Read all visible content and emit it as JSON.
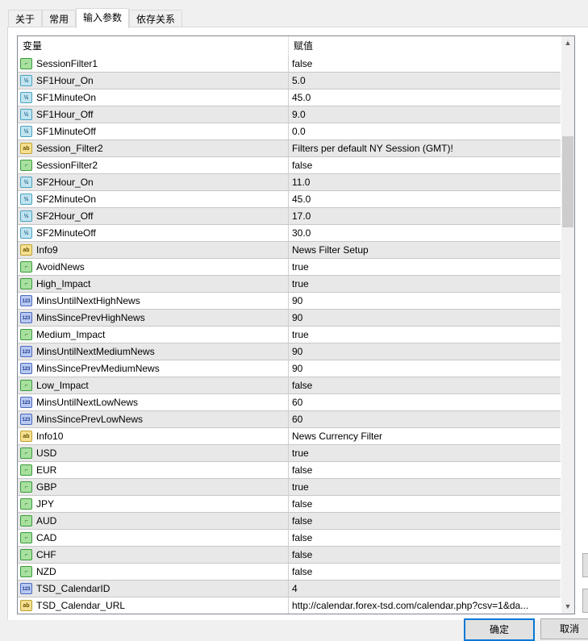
{
  "tabs": [
    "关于",
    "常用",
    "输入参数",
    "依存关系"
  ],
  "active_tab": 2,
  "columns": {
    "variable": "变量",
    "value": "赋值"
  },
  "rows": [
    {
      "icon": "bool",
      "name": "SessionFilter1",
      "value": "false"
    },
    {
      "icon": "dbl",
      "name": "SF1Hour_On",
      "value": "5.0"
    },
    {
      "icon": "dbl",
      "name": "SF1MinuteOn",
      "value": "45.0"
    },
    {
      "icon": "dbl",
      "name": "SF1Hour_Off",
      "value": "9.0"
    },
    {
      "icon": "dbl",
      "name": "SF1MinuteOff",
      "value": "0.0"
    },
    {
      "icon": "str",
      "name": "Session_Filter2",
      "value": "Filters per default NY Session (GMT)!"
    },
    {
      "icon": "bool",
      "name": "SessionFilter2",
      "value": "false"
    },
    {
      "icon": "dbl",
      "name": "SF2Hour_On",
      "value": "11.0"
    },
    {
      "icon": "dbl",
      "name": "SF2MinuteOn",
      "value": "45.0"
    },
    {
      "icon": "dbl",
      "name": "SF2Hour_Off",
      "value": "17.0"
    },
    {
      "icon": "dbl",
      "name": "SF2MinuteOff",
      "value": "30.0"
    },
    {
      "icon": "str",
      "name": "Info9",
      "value": "News Filter Setup"
    },
    {
      "icon": "bool",
      "name": "AvoidNews",
      "value": "true"
    },
    {
      "icon": "bool",
      "name": "High_Impact",
      "value": "true"
    },
    {
      "icon": "int",
      "name": "MinsUntilNextHighNews",
      "value": "90"
    },
    {
      "icon": "int",
      "name": "MinsSincePrevHighNews",
      "value": "90"
    },
    {
      "icon": "bool",
      "name": "Medium_Impact",
      "value": "true"
    },
    {
      "icon": "int",
      "name": "MinsUntilNextMediumNews",
      "value": "90"
    },
    {
      "icon": "int",
      "name": "MinsSincePrevMediumNews",
      "value": "90"
    },
    {
      "icon": "bool",
      "name": "Low_Impact",
      "value": "false"
    },
    {
      "icon": "int",
      "name": "MinsUntilNextLowNews",
      "value": "60"
    },
    {
      "icon": "int",
      "name": "MinsSincePrevLowNews",
      "value": "60"
    },
    {
      "icon": "str",
      "name": "Info10",
      "value": "News Currency Filter"
    },
    {
      "icon": "bool",
      "name": "USD",
      "value": "true"
    },
    {
      "icon": "bool",
      "name": "EUR",
      "value": "false"
    },
    {
      "icon": "bool",
      "name": "GBP",
      "value": "true"
    },
    {
      "icon": "bool",
      "name": "JPY",
      "value": "false"
    },
    {
      "icon": "bool",
      "name": "AUD",
      "value": "false"
    },
    {
      "icon": "bool",
      "name": "CAD",
      "value": "false"
    },
    {
      "icon": "bool",
      "name": "CHF",
      "value": "false"
    },
    {
      "icon": "bool",
      "name": "NZD",
      "value": "false"
    },
    {
      "icon": "int",
      "name": "TSD_CalendarID",
      "value": "4"
    },
    {
      "icon": "str",
      "name": "TSD_Calendar_URL",
      "value": "http://calendar.forex-tsd.com/calendar.php?csv=1&da..."
    }
  ],
  "icon_glyphs": {
    "bool": "⌐",
    "dbl": "½",
    "int": "123",
    "str": "ab"
  },
  "buttons": {
    "ok": "确定",
    "cancel": "取消"
  }
}
